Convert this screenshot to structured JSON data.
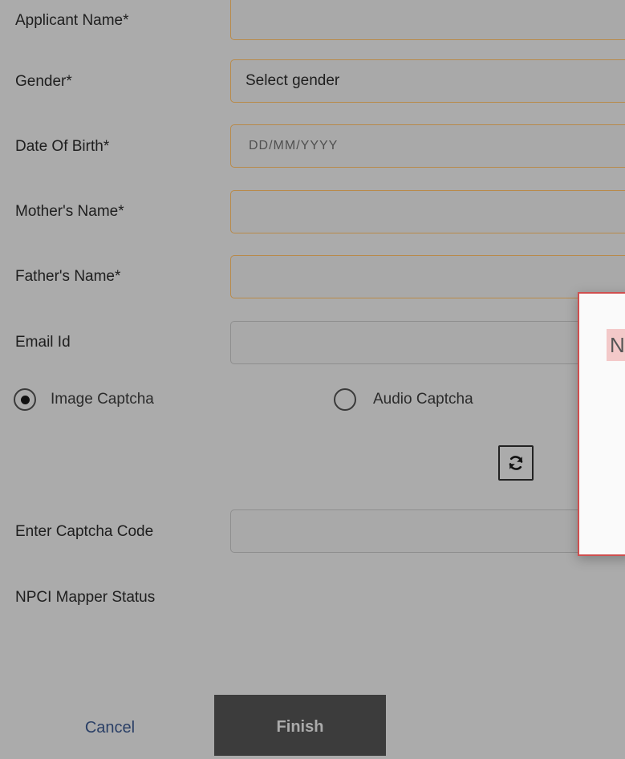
{
  "form": {
    "applicant_name": {
      "label": "Applicant Name*",
      "value": ""
    },
    "gender": {
      "label": "Gender*",
      "value": "Select gender"
    },
    "dob": {
      "label": "Date Of Birth*",
      "placeholder": "DD/MM/YYYY"
    },
    "mother_name": {
      "label": "Mother's Name*",
      "value": ""
    },
    "father_name": {
      "label": "Father's Name*",
      "value": ""
    },
    "email": {
      "label": "Email Id",
      "value": ""
    },
    "captcha_type": {
      "image_label": "Image Captcha",
      "audio_label": "Audio Captcha",
      "selected": "image"
    },
    "refresh_icon": "refresh-icon",
    "captcha_code": {
      "label": "Enter Captcha Code",
      "value": ""
    },
    "npci_status": {
      "label": "NPCI Mapper Status"
    }
  },
  "actions": {
    "cancel_label": "Cancel",
    "finish_label": "Finish"
  },
  "modal": {
    "partial_text": "N"
  },
  "colors": {
    "overlay": "#ababab",
    "required_border": "#b88a4a",
    "modal_border": "#cf4f4f",
    "finish_bg": "#3c3c3c",
    "cancel_text": "#2a3f66"
  }
}
